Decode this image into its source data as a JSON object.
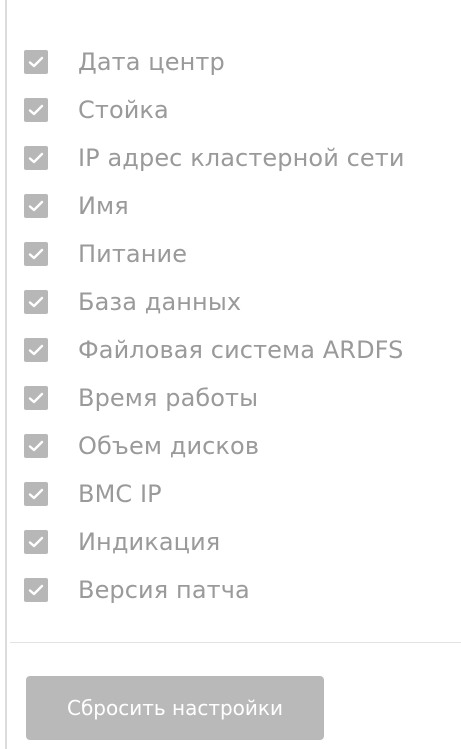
{
  "columns_menu": {
    "items": [
      {
        "label": "Дата центр",
        "checked": true
      },
      {
        "label": "Стойка",
        "checked": true
      },
      {
        "label": "IP адрес кластерной сети",
        "checked": true
      },
      {
        "label": "Имя",
        "checked": true
      },
      {
        "label": "Питание",
        "checked": true
      },
      {
        "label": "База данных",
        "checked": true
      },
      {
        "label": "Файловая система ARDFS",
        "checked": true
      },
      {
        "label": "Время работы",
        "checked": true
      },
      {
        "label": "Объем дисков",
        "checked": true
      },
      {
        "label": "BMC IP",
        "checked": true
      },
      {
        "label": "Индикация",
        "checked": true
      },
      {
        "label": "Версия патча",
        "checked": true
      }
    ],
    "reset_label": "Сбросить настройки"
  },
  "icons": {
    "checkbox": "checkmark-icon"
  },
  "colors": {
    "checkbox_bg": "#b7b7b7",
    "label_text": "#9a9a9a",
    "button_bg": "#b9b9b9",
    "button_text": "#ffffff"
  }
}
